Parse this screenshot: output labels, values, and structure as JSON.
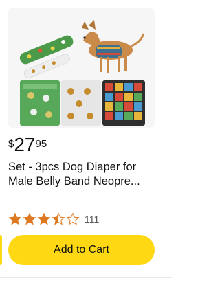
{
  "product": {
    "image_alt": "dog belly band diapers set",
    "price": {
      "symbol": "$",
      "whole": "27",
      "fraction": "95"
    },
    "title_line1": "Set - 3pcs Dog Diaper for",
    "title_line2": "Male Belly Band Neopre...",
    "rating": {
      "value": 3.5,
      "max": 5,
      "count": "111"
    },
    "add_to_cart_label": "Add to Cart"
  },
  "colors": {
    "button": "#ffd814",
    "star": "#de7921",
    "text": "#0f1111",
    "muted": "#565959"
  }
}
